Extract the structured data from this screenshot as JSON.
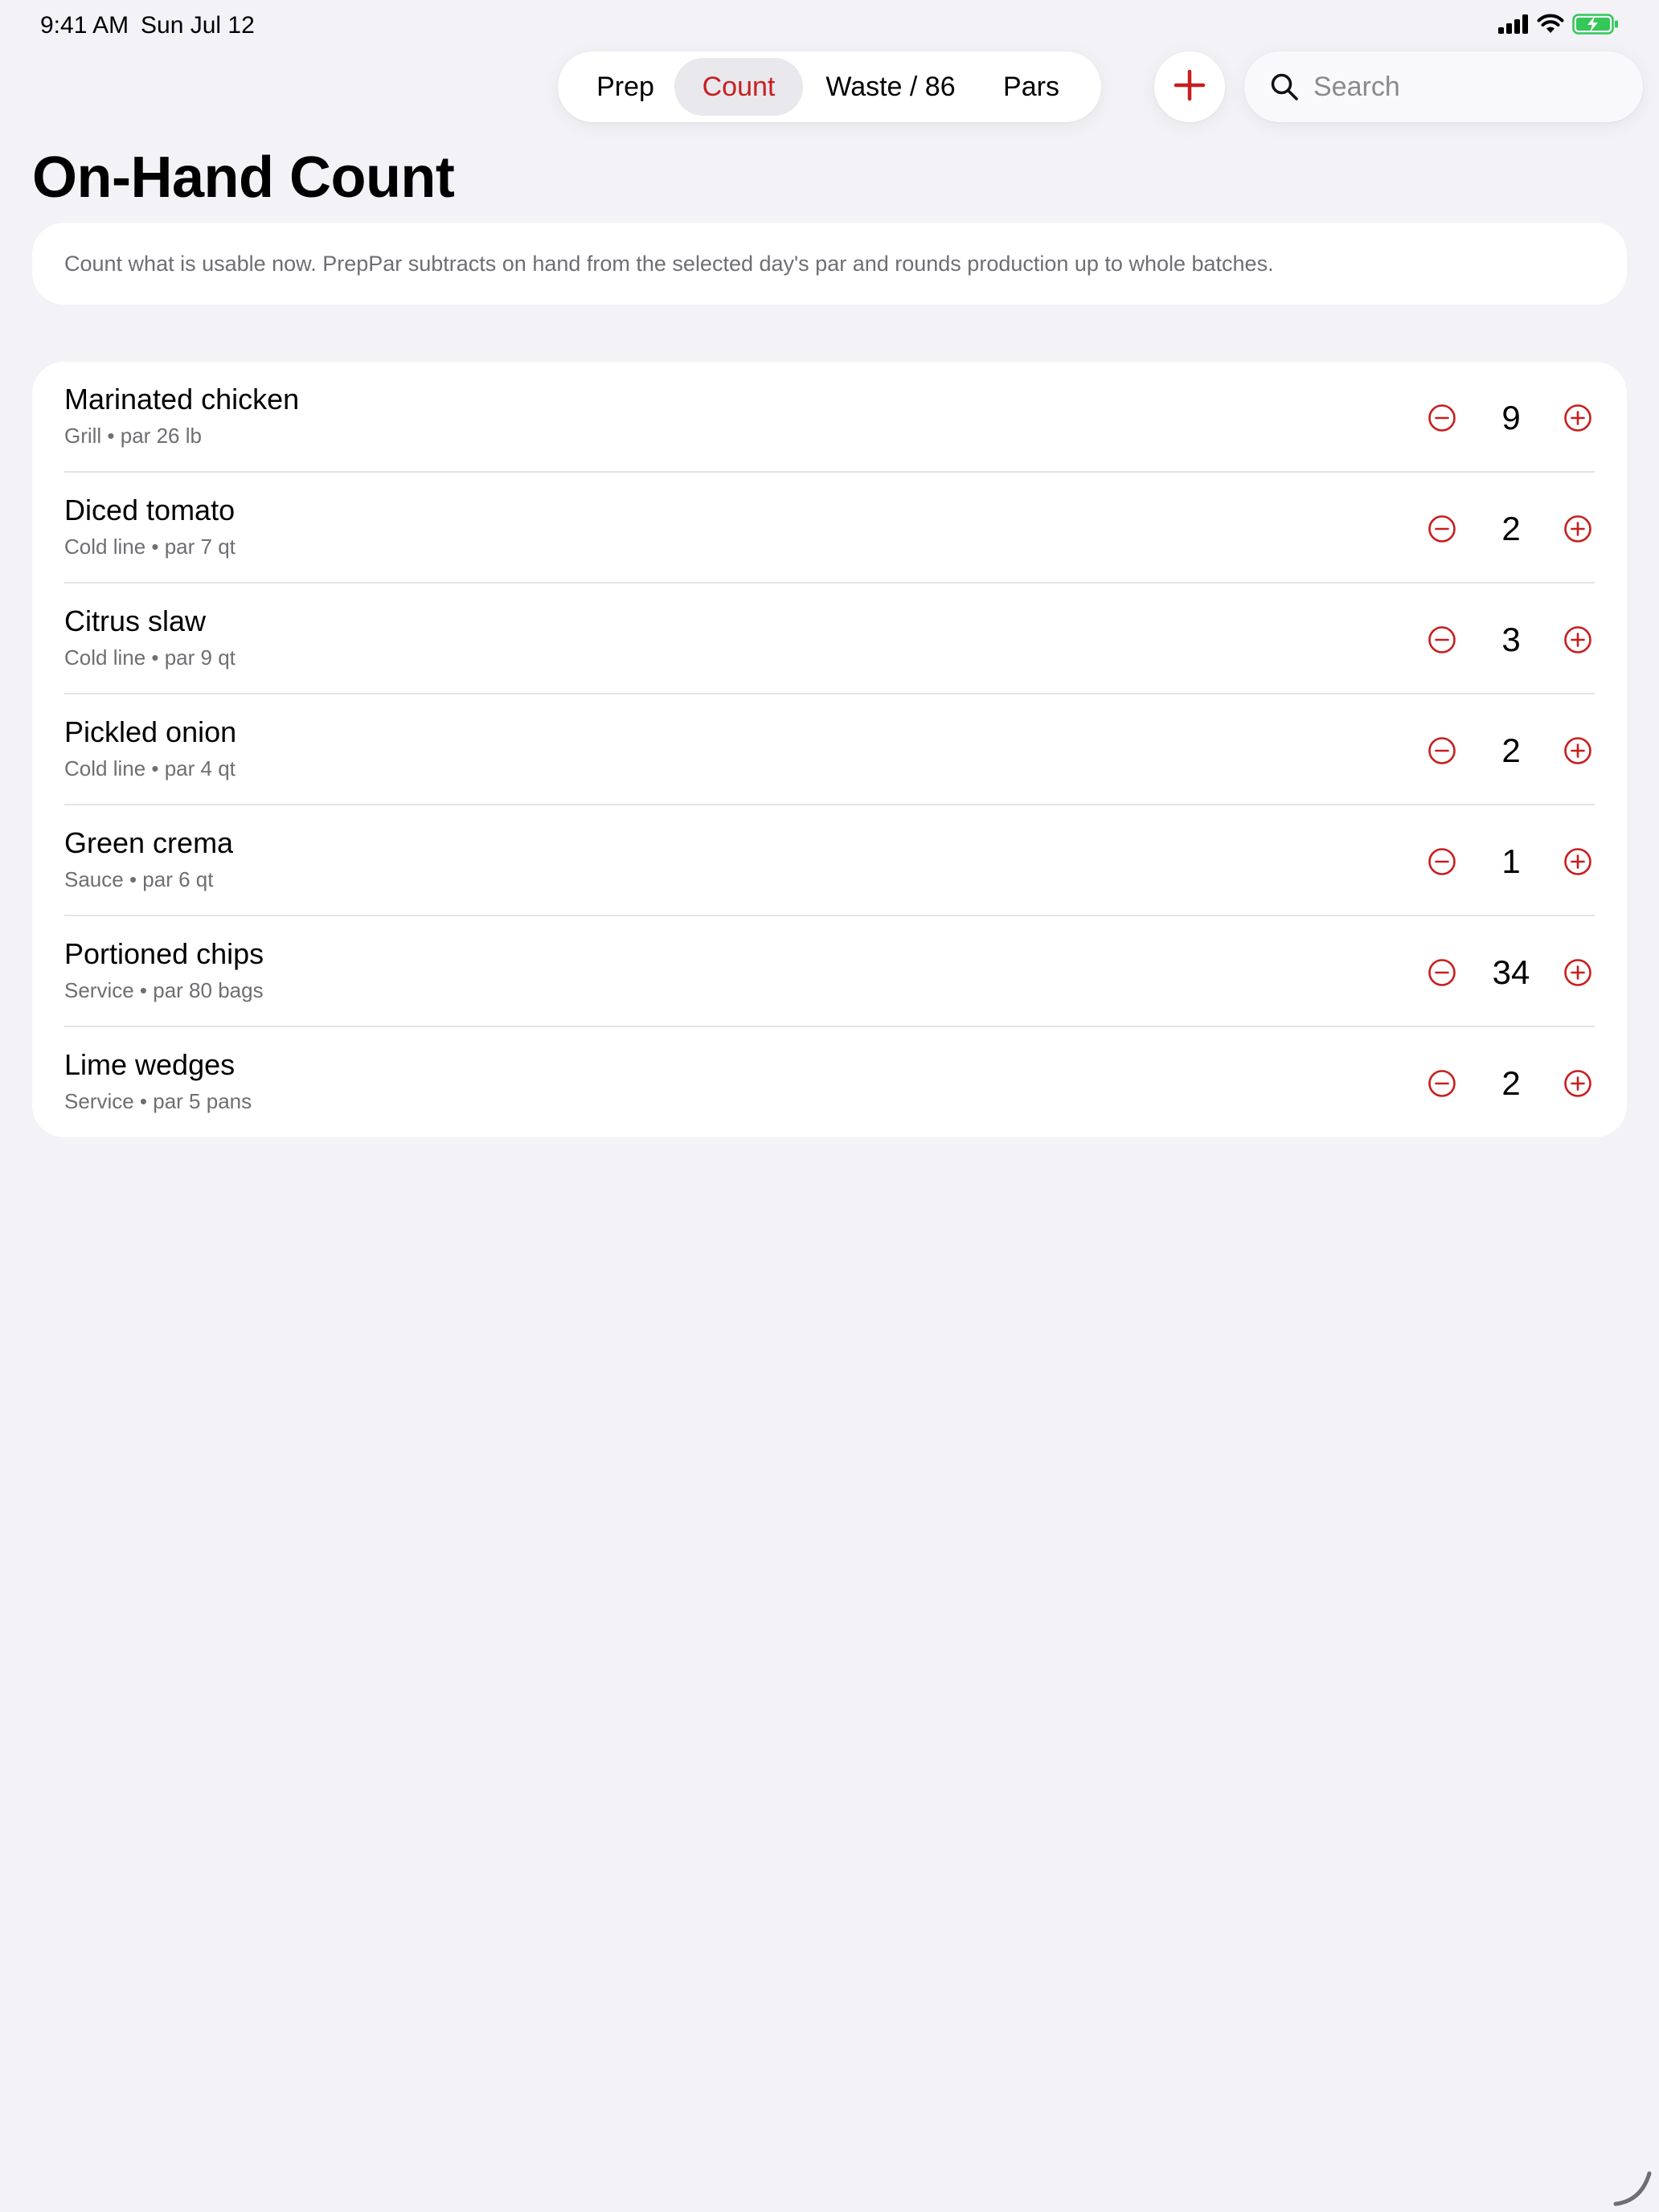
{
  "status_bar": {
    "time": "9:41 AM",
    "date": "Sun Jul 12"
  },
  "tabs": [
    {
      "label": "Prep",
      "active": false
    },
    {
      "label": "Count",
      "active": true
    },
    {
      "label": "Waste / 86",
      "active": false
    },
    {
      "label": "Pars",
      "active": false
    }
  ],
  "search": {
    "placeholder": "Search",
    "value": ""
  },
  "page": {
    "title": "On-Hand Count",
    "info": "Count what is usable now. PrepPar subtracts on hand from the selected day's par and rounds production up to whole batches."
  },
  "items": [
    {
      "name": "Marinated chicken",
      "subtitle": "Grill • par 26 lb",
      "count": "9"
    },
    {
      "name": "Diced tomato",
      "subtitle": "Cold line • par 7 qt",
      "count": "2"
    },
    {
      "name": "Citrus slaw",
      "subtitle": "Cold line • par 9 qt",
      "count": "3"
    },
    {
      "name": "Pickled onion",
      "subtitle": "Cold line • par 4 qt",
      "count": "2"
    },
    {
      "name": "Green crema",
      "subtitle": "Sauce • par 6 qt",
      "count": "1"
    },
    {
      "name": "Portioned chips",
      "subtitle": "Service • par 80 bags",
      "count": "34"
    },
    {
      "name": "Lime wedges",
      "subtitle": "Service • par 5 pans",
      "count": "2"
    }
  ],
  "colors": {
    "accent": "#c81e1e",
    "background": "#f2f2f7",
    "card": "#ffffff",
    "secondary_text": "#6e6e73",
    "battery_green": "#34c759"
  }
}
